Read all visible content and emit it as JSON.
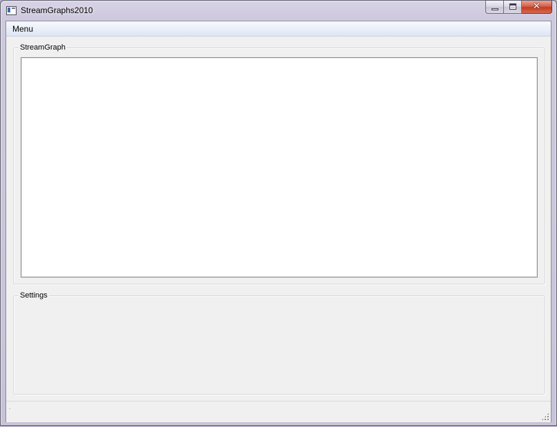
{
  "window": {
    "title": "StreamGraphs2010",
    "close_glyph": "✕"
  },
  "menubar": {
    "items": [
      {
        "label": "Menu"
      }
    ]
  },
  "groups": {
    "streamgraph": {
      "title": "StreamGraph"
    },
    "settings": {
      "title": "Settings"
    }
  },
  "statusbar": {
    "text": "."
  },
  "icons": {
    "app": "app-window-icon",
    "minimize": "minimize-icon",
    "maximize": "maximize-icon",
    "close": "close-icon",
    "grip": "size-grip-icon"
  },
  "colors": {
    "client_bg": "#f0f0f0",
    "canvas_bg": "#ffffff",
    "close_button": "#c84830"
  }
}
